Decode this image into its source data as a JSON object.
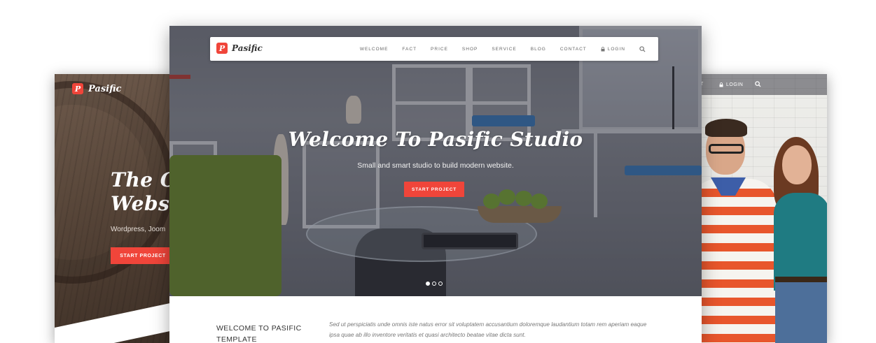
{
  "left_preview": {
    "brand": "Pasific",
    "logo_letter": "P",
    "title": "The On\nWebsit",
    "subtitle": "Wordpress, Joom",
    "button_label": "START PROJECT"
  },
  "main_preview": {
    "nav": {
      "brand": "Pasific",
      "logo_letter": "P",
      "items": [
        "WELCOME",
        "FACT",
        "PRICE",
        "SHOP",
        "SERVICE",
        "BLOG",
        "CONTACT"
      ],
      "login_label": "LOGIN"
    },
    "hero": {
      "title": "Welcome To Pasific Studio",
      "subtitle": "Small and smart studio to build modern website.",
      "button_label": "START PROJECT",
      "slide_count": 3,
      "active_slide": 1
    },
    "intro": {
      "heading": "WELCOME TO PASIFIC\nTEMPLATE",
      "paragraph": "Sed ut perspiciatis unde omnis iste natus error sit voluptatem accusantium doloremque laudantium totam rem aperiam eaque ipsa quae ab illo inventore veritatis et quasi architecto beatae vitae dicta sunt."
    }
  },
  "right_preview": {
    "nav_edge": "T",
    "login_label": "LOGIN"
  },
  "colors": {
    "accent": "#f0453a",
    "nav_text": "#666666"
  }
}
